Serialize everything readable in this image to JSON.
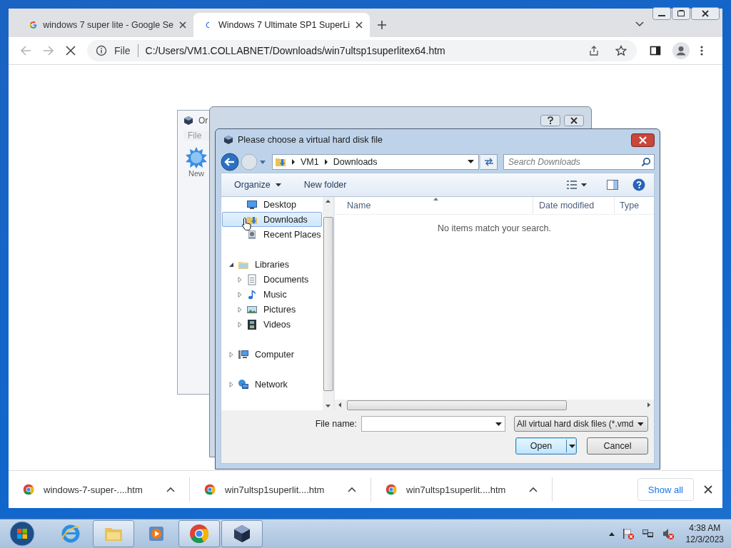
{
  "browser": {
    "tabs": [
      {
        "kind": "google",
        "title": "windows 7 super lite - Google Se",
        "selected": false
      },
      {
        "kind": "loading",
        "title": "Windows 7 Ultimate SP1 SuperLi",
        "selected": true
      }
    ],
    "address": {
      "scheme": "File",
      "url": "C:/Users/VM1.COLLABNET/Downloads/win7ultsp1superlitex64.htm"
    }
  },
  "manager_window": {
    "title": "Or",
    "menu": [
      "File"
    ],
    "tools": [
      "New"
    ]
  },
  "file_dialog": {
    "title": "Please choose a virtual hard disk file",
    "breadcrumb": [
      "VM1",
      "Downloads"
    ],
    "search": {
      "placeholder": "Search Downloads"
    },
    "toolbar": [
      "Organize",
      "New folder"
    ],
    "favorites": [
      {
        "kind": "desktop",
        "label": "Desktop",
        "selected": false
      },
      {
        "kind": "downloads",
        "label": "Downloads",
        "selected": true
      },
      {
        "kind": "recent",
        "label": "Recent Places",
        "selected": false
      }
    ],
    "tree": [
      {
        "kind": "library",
        "label": "Libraries",
        "expanded": true,
        "children": [
          {
            "kind": "documents",
            "label": "Documents",
            "expanded": false
          },
          {
            "kind": "music",
            "label": "Music",
            "expanded": false
          },
          {
            "kind": "pictures",
            "label": "Pictures",
            "expanded": false
          },
          {
            "kind": "videos",
            "label": "Videos",
            "expanded": false
          }
        ]
      },
      {
        "kind": "computer",
        "label": "Computer",
        "expanded": false
      },
      {
        "kind": "network",
        "label": "Network",
        "expanded": false
      }
    ],
    "columns": [
      "Name",
      "Date modified",
      "Type"
    ],
    "empty_message": "No items match your search.",
    "file_name": {
      "label": "File name:"
    },
    "file_type": "All virtual hard disk files (*.vmd",
    "buttons": [
      {
        "label": "Open",
        "kind": "split",
        "default": true
      },
      {
        "label": "Cancel",
        "kind": "plain",
        "default": false
      }
    ]
  },
  "downloads": [
    {
      "name": "windows-7-super-....htm"
    },
    {
      "name": "win7ultsp1superlit....htm"
    },
    {
      "name": "win7ultsp1superlit....htm"
    }
  ],
  "show_all": "Show all",
  "taskbar": [
    {
      "kind": "ie",
      "running": false
    },
    {
      "kind": "explorer",
      "running": true
    },
    {
      "kind": "media",
      "running": false
    },
    {
      "kind": "chrome",
      "running": true
    },
    {
      "kind": "virtualbox",
      "running": true
    }
  ],
  "clock": {
    "time": "4:38 AM",
    "date": "12/3/2023"
  }
}
